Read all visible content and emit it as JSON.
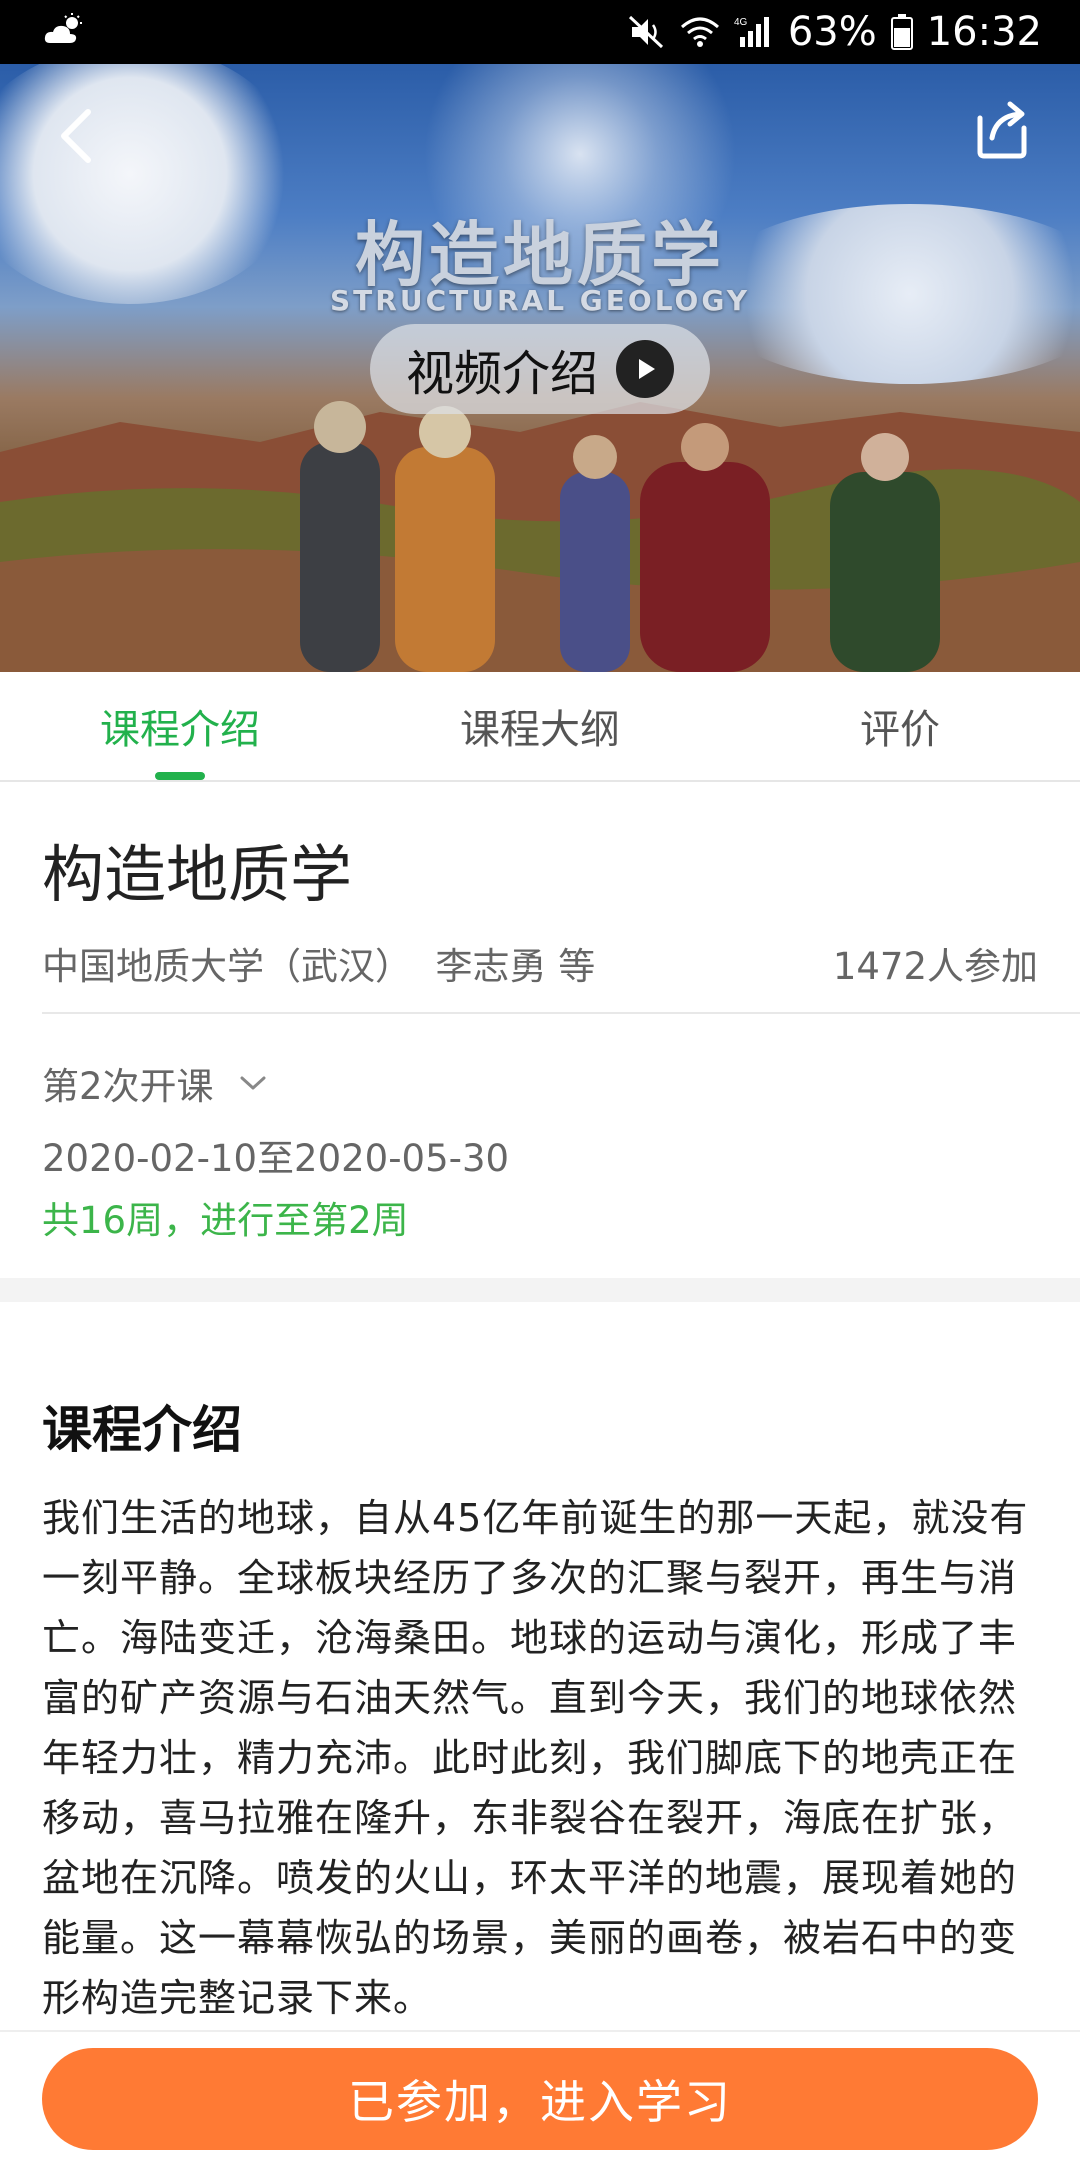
{
  "status_bar": {
    "battery": "63%",
    "time": "16:32",
    "network": "4G",
    "icons": [
      "weather-icon",
      "mute-icon",
      "wifi-icon",
      "signal-icon",
      "battery-icon"
    ]
  },
  "hero": {
    "title_cn": "构造地质学",
    "title_en": "STRUCTURAL GEOLOGY",
    "video_button_label": "视频介绍"
  },
  "tabs": [
    {
      "label": "课程介绍",
      "active": true
    },
    {
      "label": "课程大纲",
      "active": false
    },
    {
      "label": "评价",
      "active": false
    }
  ],
  "course": {
    "title": "构造地质学",
    "institution_teacher": "中国地质大学（武汉）  李志勇 等",
    "participants": "1472人参加",
    "session": "第2次开课",
    "dates": "2020-02-10至2020-05-30",
    "progress": "共16周，进行至第2周"
  },
  "intro": {
    "heading": "课程介绍",
    "body": "我们生活的地球，自从45亿年前诞生的那一天起，就没有一刻平静。全球板块经历了多次的汇聚与裂开，再生与消亡。海陆变迁，沧海桑田。地球的运动与演化，形成了丰富的矿产资源与石油天然气。直到今天，我们的地球依然年轻力壮，精力充沛。此时此刻，我们脚底下的地壳正在移动，喜马拉雅在隆升，东非裂谷在裂开，海底在扩张，盆地在沉降。喷发的火山，环太平洋的地震，展现着她的能量。这一幕幕恢弘的场景，美丽的画卷，被岩石中的变形构造完整记录下来。"
  },
  "action": {
    "join_label": "已参加，进入学习"
  },
  "colors": {
    "accent_green": "#22b14c",
    "button_orange": "#ff7a34"
  }
}
